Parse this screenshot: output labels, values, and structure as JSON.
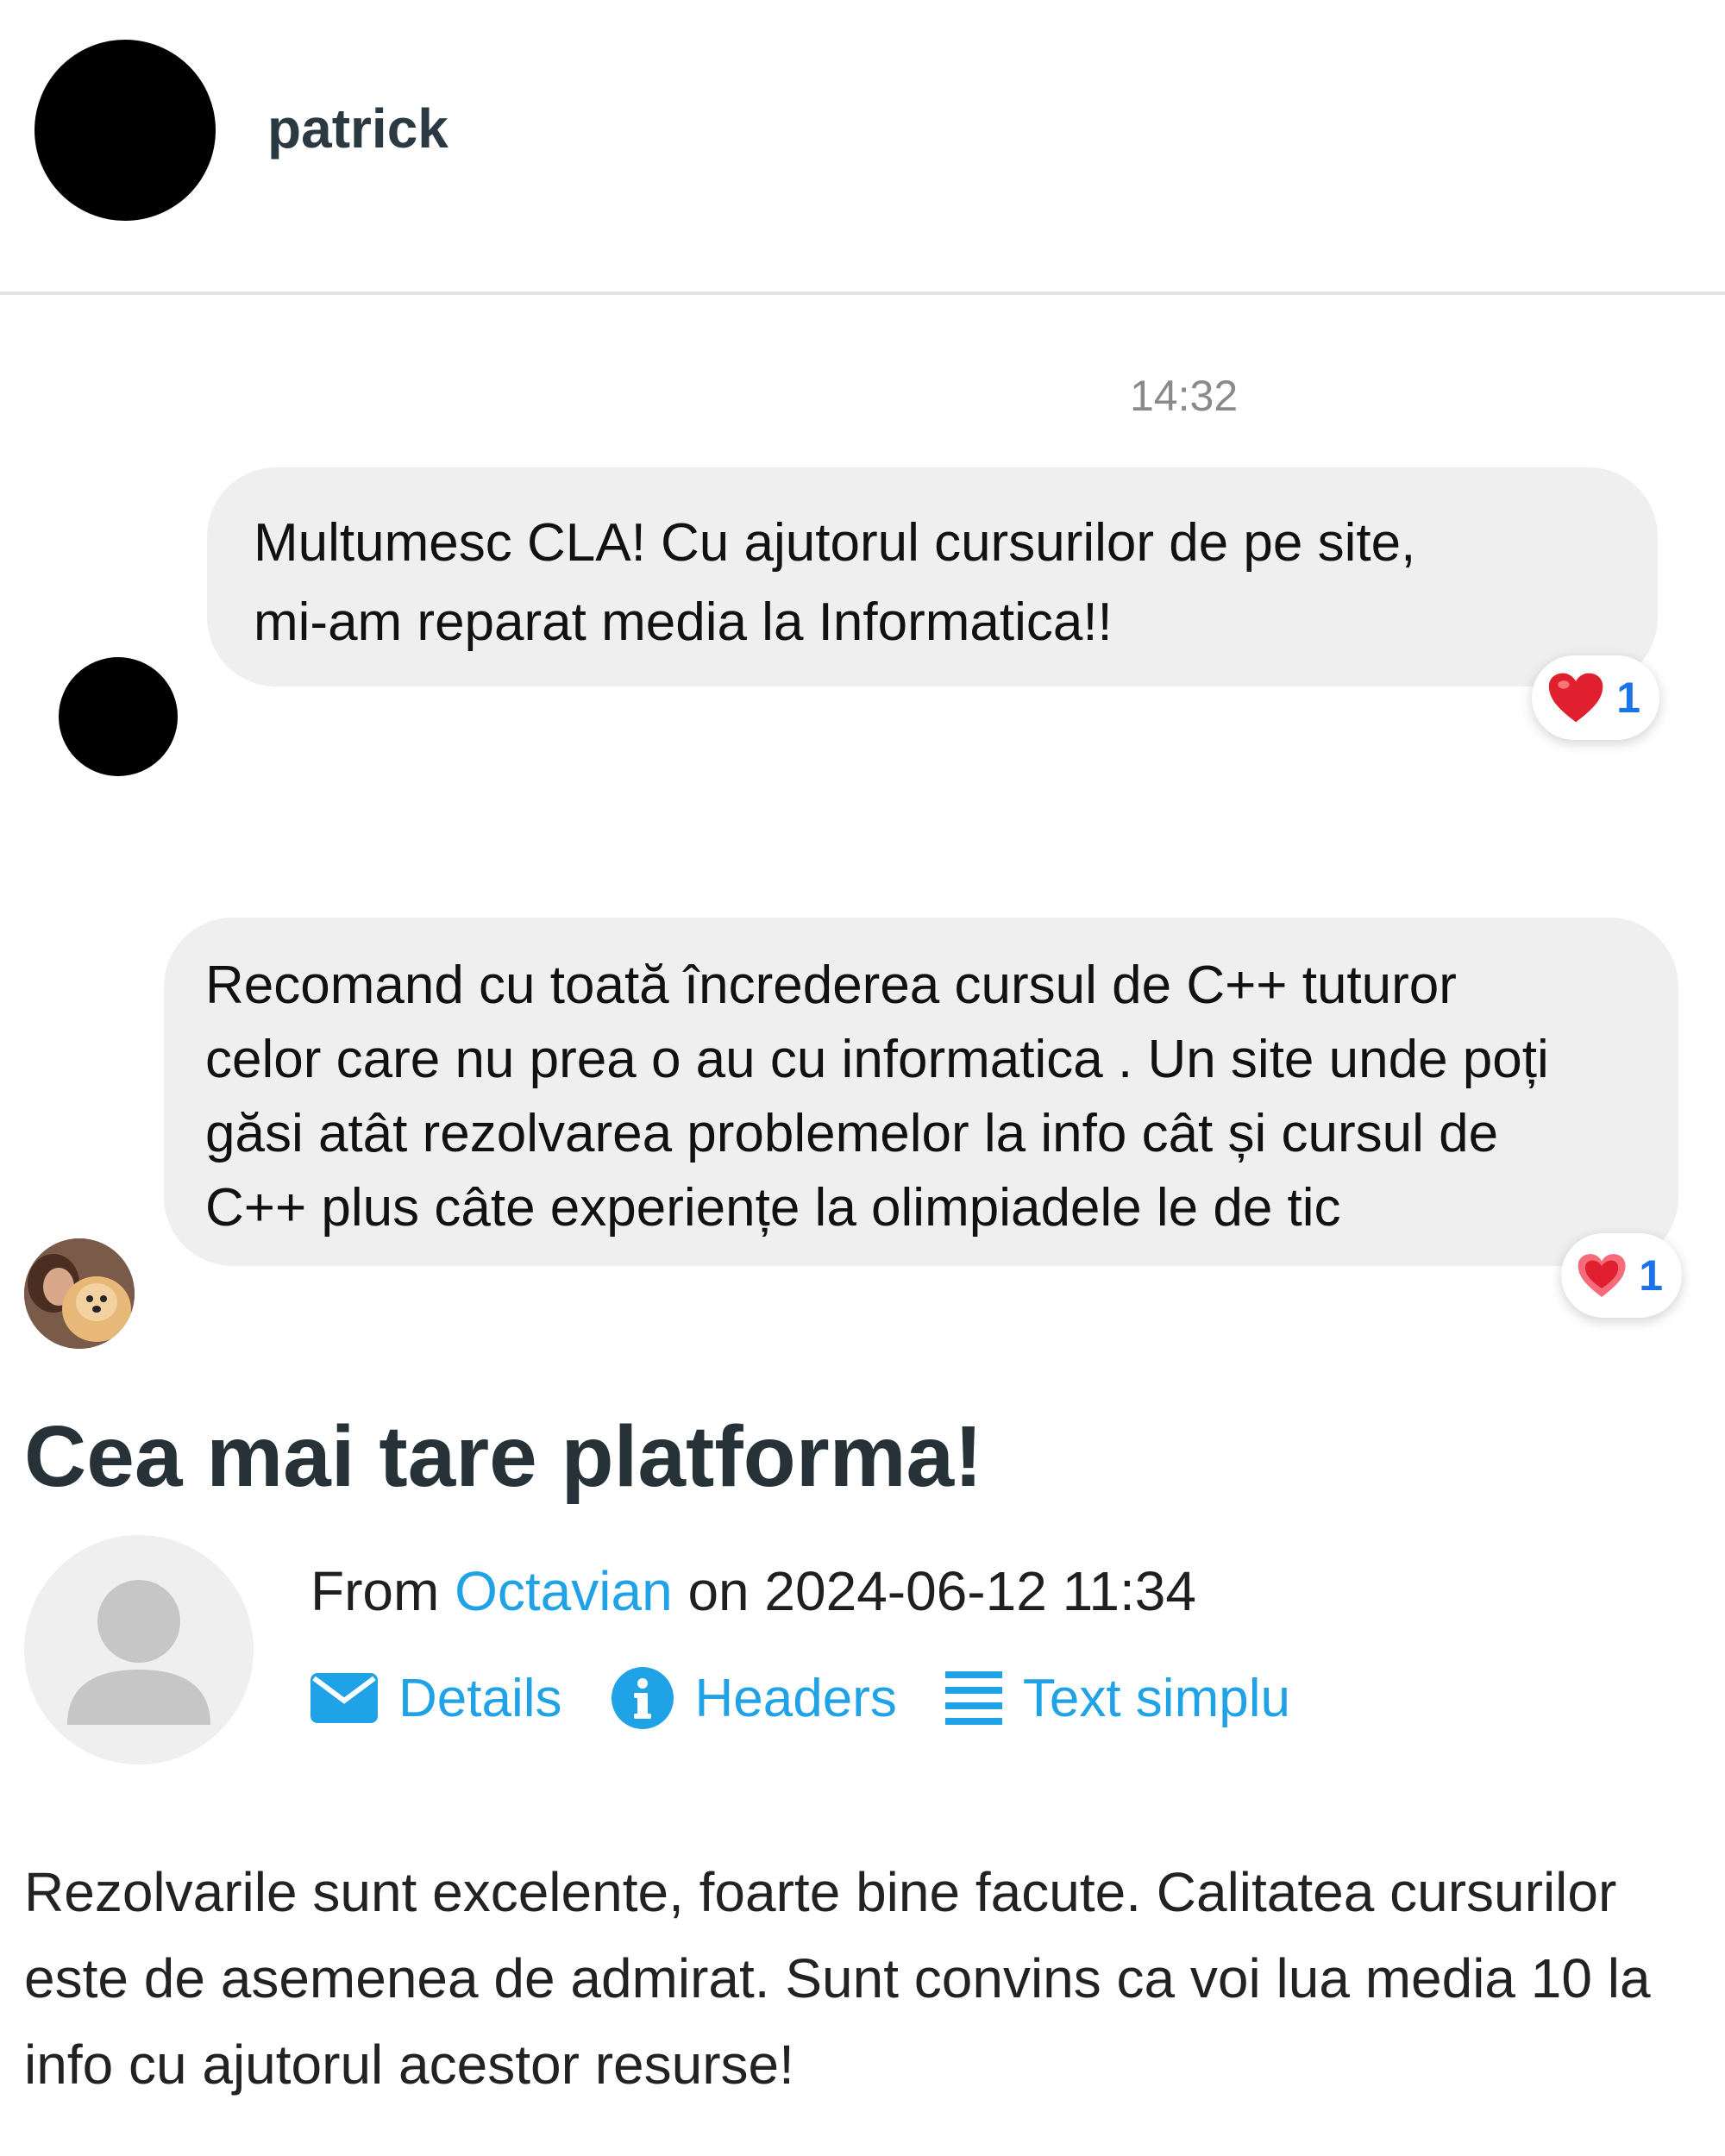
{
  "header": {
    "contact_name": "patrick"
  },
  "chat": {
    "timestamp": "14:32",
    "messages": [
      {
        "lines": [
          "Multumesc CLA! Cu ajutorul cursurilor de pe site,",
          "mi-am reparat media la Informatica!!"
        ],
        "reaction": {
          "icon": "heart-icon",
          "count": "1"
        }
      },
      {
        "lines": [
          "Recomand cu toată încrederea cursul de C++ tuturor",
          "celor care nu prea o au cu informatica .  Un site unde poți",
          "găsi atât rezolvarea problemelor la info cât și cursul de",
          "C++ plus câte experiențe la olimpiadele le de tic"
        ],
        "reaction": {
          "icon": "heart-icon",
          "count": "1"
        }
      }
    ]
  },
  "review": {
    "title": "Cea mai tare platforma!",
    "from_label": "From",
    "author": "Octavian",
    "on_label": "on",
    "date": "2024-06-12 11:34",
    "actions": [
      {
        "label": "Details",
        "icon": "envelope-icon"
      },
      {
        "label": "Headers",
        "icon": "info-icon"
      },
      {
        "label": "Text simplu",
        "icon": "lines-icon"
      }
    ],
    "body_lines": [
      "Rezolvarile sunt excelente, foarte bine facute. Calitatea cursurilor",
      "este de asemenea de admirat. Sunt convins ca voi lua media 10 la",
      "info cu ajutorul acestor resurse!"
    ]
  },
  "colors": {
    "link": "#1fa2e6",
    "bubble": "#efefef",
    "reaction_count": "#1a73e8",
    "heart": "#e0202e"
  }
}
